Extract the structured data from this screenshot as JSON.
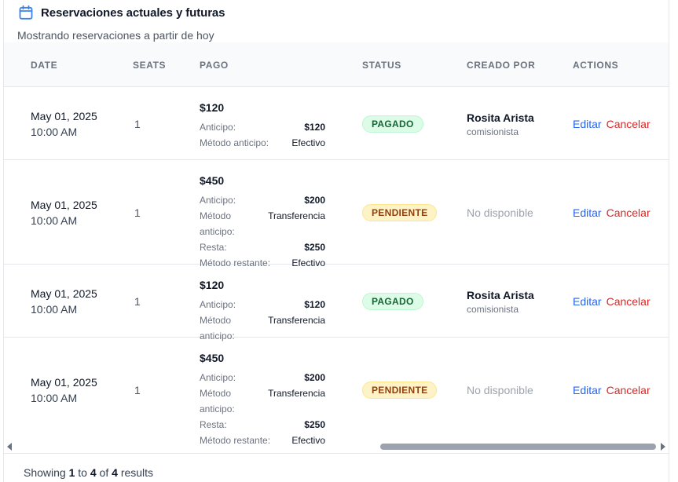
{
  "header": {
    "title": "Reservaciones actuales y futuras",
    "subtitle": "Mostrando reservaciones a partir de hoy",
    "icon": "calendar-icon",
    "accent_color": "#3b82f6"
  },
  "table": {
    "columns": [
      "DATE",
      "SEATS",
      "PAGO",
      "STATUS",
      "CREADO POR",
      "ACTIONS"
    ],
    "rows": [
      {
        "date": "May 01, 2025",
        "time": "10:00 AM",
        "seats": "1",
        "pago_total": "$120",
        "pago_lines": [
          {
            "label": "Anticipo:",
            "value": "$120",
            "bold": true
          },
          {
            "label": "Método anticipo:",
            "value": "Efectivo",
            "bold": false
          }
        ],
        "status": "PAGADO",
        "status_type": "paid",
        "creator_name": "Rosita Arista",
        "creator_role": "comisionista",
        "creator_na": "",
        "edit_label": "Editar",
        "cancel_label": "Cancelar"
      },
      {
        "date": "May 01, 2025",
        "time": "10:00 AM",
        "seats": "1",
        "pago_total": "$450",
        "pago_lines": [
          {
            "label": "Anticipo:",
            "value": "$200",
            "bold": true
          },
          {
            "label": "Método anticipo:",
            "value": "Transferencia",
            "bold": false
          },
          {
            "label": "Resta:",
            "value": "$250",
            "bold": true
          },
          {
            "label": "Método restante:",
            "value": "Efectivo",
            "bold": false
          }
        ],
        "status": "PENDIENTE",
        "status_type": "pending",
        "creator_name": "",
        "creator_role": "",
        "creator_na": "No disponible",
        "edit_label": "Editar",
        "cancel_label": "Cancelar"
      },
      {
        "date": "May 01, 2025",
        "time": "10:00 AM",
        "seats": "1",
        "pago_total": "$120",
        "pago_lines": [
          {
            "label": "Anticipo:",
            "value": "$120",
            "bold": true
          },
          {
            "label": "Método anticipo:",
            "value": "Transferencia",
            "bold": false
          }
        ],
        "status": "PAGADO",
        "status_type": "paid",
        "creator_name": "Rosita Arista",
        "creator_role": "comisionista",
        "creator_na": "",
        "edit_label": "Editar",
        "cancel_label": "Cancelar"
      },
      {
        "date": "May 01, 2025",
        "time": "10:00 AM",
        "seats": "1",
        "pago_total": "$450",
        "pago_lines": [
          {
            "label": "Anticipo:",
            "value": "$200",
            "bold": true
          },
          {
            "label": "Método anticipo:",
            "value": "Transferencia",
            "bold": false
          },
          {
            "label": "Resta:",
            "value": "$250",
            "bold": true
          },
          {
            "label": "Método restante:",
            "value": "Efectivo",
            "bold": false
          }
        ],
        "status": "PENDIENTE",
        "status_type": "pending",
        "creator_name": "",
        "creator_role": "",
        "creator_na": "No disponible",
        "edit_label": "Editar",
        "cancel_label": "Cancelar"
      }
    ]
  },
  "footer": {
    "showing": "Showing",
    "from": "1",
    "to_word": "to",
    "to": "4",
    "of_word": "of",
    "total": "4",
    "results": "results"
  }
}
